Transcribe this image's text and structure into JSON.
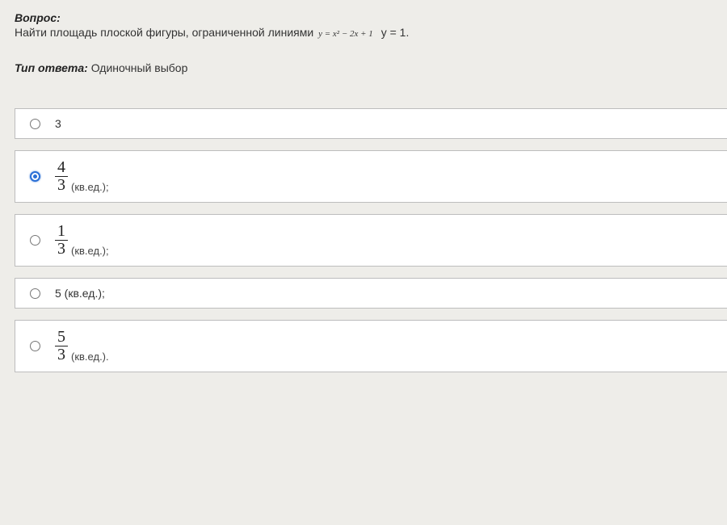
{
  "question": {
    "label": "Вопрос:",
    "text_before": "Найти площадь плоской фигуры, ограниченной линиями ",
    "formula": "y = x² − 2x + 1",
    "text_after": "  y = 1."
  },
  "answer_type": {
    "label": "Тип ответа:",
    "value": "Одиночный выбор"
  },
  "options": [
    {
      "kind": "plain",
      "text": "3",
      "selected": false
    },
    {
      "kind": "frac",
      "num": "4",
      "den": "3",
      "unit": " (кв.ед.);",
      "selected": true
    },
    {
      "kind": "frac",
      "num": "1",
      "den": "3",
      "unit": " (кв.ед.);",
      "selected": false
    },
    {
      "kind": "plain",
      "text": "5 (кв.ед.);",
      "selected": false
    },
    {
      "kind": "frac",
      "num": "5",
      "den": "3",
      "unit": " (кв.ед.).",
      "selected": false
    }
  ]
}
